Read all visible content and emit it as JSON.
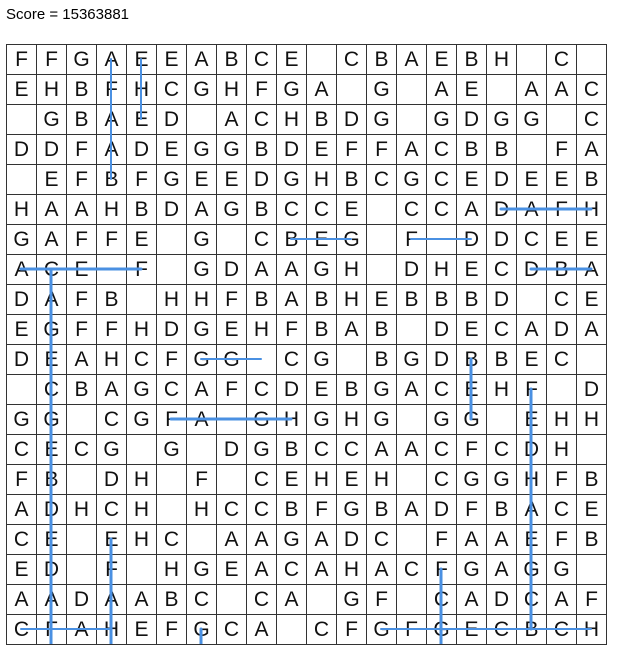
{
  "score_text": "Score = 15363881",
  "board": {
    "rows": [
      "FFGAEEABCE CBAEBH C ",
      "EHBFHCGHFGA G AE AAC",
      " GBAED ACHBDG GDGG C",
      "DDFADEGGBDEFFACBB FA",
      " EFBFGEEDGHBCGCEDEEB",
      "HAAHBDAGBCCE CCADAFH",
      "GAFFE G CBEG F DDCEE",
      "ACE F GDAAGH DHECDBA",
      "DAFB HHFBABHEBBBD CE",
      "EGFFHDGEHFBAB DECADA",
      "DEAHCFGG CG BGDBBEC ",
      " CBAGCAFCDEBGACEHF D",
      "GG CGFA GHGHG GG EHH",
      "CECG G DGBCCAACFCDH ",
      "FB DH F CEHEH CGGHFB",
      "ADHCH HCCBFGBADFBACE",
      "CE EHC AAGADC FAAEFB",
      "ED F HGEACAHACFGAGG",
      "AADAABC CA GF CADCAF",
      "CFAHEFGCA CFGFGECBCH"
    ],
    "accent_color": "#4a90e2",
    "grid_color": "#333333"
  }
}
